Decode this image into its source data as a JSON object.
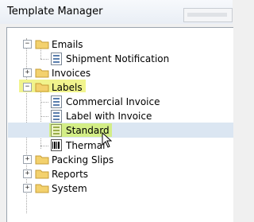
{
  "window": {
    "title": "Template Manager"
  },
  "tree": {
    "items": [
      {
        "label": "Emails",
        "expanded": true
      },
      {
        "label": "Shipment Notification"
      },
      {
        "label": "Invoices",
        "expanded": false
      },
      {
        "label": "Labels",
        "expanded": true
      },
      {
        "label": "Commercial Invoice"
      },
      {
        "label": "Label with Invoice"
      },
      {
        "label": "Standard",
        "selected": true
      },
      {
        "label": "Thermal"
      },
      {
        "label": "Packing Slips",
        "expanded": false
      },
      {
        "label": "Reports",
        "expanded": false
      },
      {
        "label": "System",
        "expanded": false
      }
    ]
  },
  "symbols": {
    "expanded": "−",
    "collapsed": "+"
  },
  "colors": {
    "highlight": "#f1f48d",
    "selection": "#dbe6f2",
    "folder": "#f3d16d"
  }
}
